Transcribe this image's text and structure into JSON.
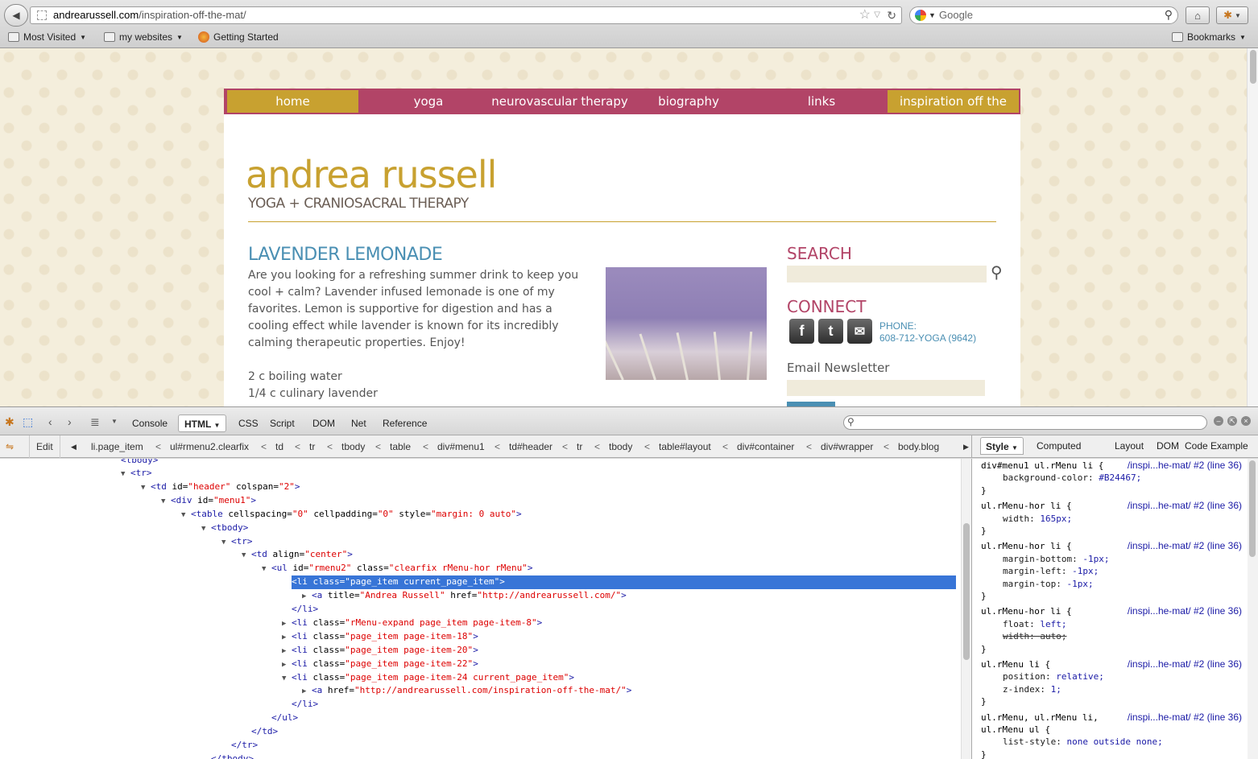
{
  "browser": {
    "url_host": "andrearussell.com",
    "url_path": "/inspiration-off-the-mat/",
    "search_placeholder": "Google",
    "bookmarks": [
      {
        "label": "Most Visited"
      },
      {
        "label": "my websites"
      },
      {
        "label": "Getting Started"
      }
    ],
    "bookmarks_menu": "Bookmarks"
  },
  "site": {
    "menu": [
      "home",
      "yoga",
      "neurovascular therapy",
      "biography",
      "links",
      "inspiration off the mat"
    ],
    "menu_current": [
      "home",
      "inspiration off the mat"
    ],
    "accent_color": "#B24467",
    "gold_color": "#C8A130",
    "logo_title": "andrea russell",
    "logo_subtitle": "YOGA + CRANIOSACRAL THERAPY",
    "post_title": "LAVENDER LEMONADE",
    "post_paragraph": "Are you looking for a refreshing summer drink to keep you cool + calm? Lavender infused lemonade is one of my favorites. Lemon is supportive for digestion and has a cooling effect while lavender is known for its incredibly calming therapeutic properties.  Enjoy!",
    "ingredients": [
      "2 c boiling water",
      "1/4  c culinary lavender"
    ],
    "sidebar": {
      "search_heading": "SEARCH",
      "connect_heading": "CONNECT",
      "phone_label": "PHONE:",
      "phone_number": "608-712-YOGA (9642)",
      "newsletter_heading": "Email Newsletter"
    }
  },
  "firebug": {
    "tabs": [
      "Console",
      "HTML",
      "CSS",
      "Script",
      "DOM",
      "Net",
      "Reference"
    ],
    "selected_tab": "HTML",
    "edit_label": "Edit",
    "breadcrumbs": [
      "li.page_item",
      "ul#rmenu2.clearfix",
      "td",
      "tr",
      "tbody",
      "table",
      "div#menu1",
      "td#header",
      "tr",
      "tbody",
      "table#layout",
      "div#container",
      "div#wrapper",
      "body.blog"
    ],
    "side_tabs": [
      "Style",
      "Computed",
      "Layout",
      "DOM",
      "Code Example"
    ],
    "tree": [
      {
        "indent": 6,
        "toggle": "▼",
        "text": "<tr>"
      },
      {
        "indent": 7,
        "toggle": "▼",
        "text": "<td id=\"header\" colspan=\"2\">"
      },
      {
        "indent": 8,
        "toggle": "▼",
        "text": "<div id=\"menu1\">"
      },
      {
        "indent": 9,
        "toggle": "▼",
        "text": "<table cellspacing=\"0\" cellpadding=\"0\" style=\"margin: 0 auto\">"
      },
      {
        "indent": 10,
        "toggle": "▼",
        "text": "<tbody>"
      },
      {
        "indent": 11,
        "toggle": "▼",
        "text": "<tr>"
      },
      {
        "indent": 12,
        "toggle": "▼",
        "text": "<td align=\"center\">"
      },
      {
        "indent": 13,
        "toggle": "▼",
        "text": "<ul id=\"rmenu2\" class=\"clearfix rMenu-hor rMenu\">"
      },
      {
        "indent": 14,
        "toggle": "▼",
        "text": "<li class=\"page_item current_page_item\">",
        "selected": true
      },
      {
        "indent": 15,
        "toggle": "▶",
        "text": "<a title=\"Andrea Russell\" href=\"http://andrearussell.com/\">"
      },
      {
        "indent": 14,
        "toggle": "",
        "text": "</li>"
      },
      {
        "indent": 14,
        "toggle": "▶",
        "text": "<li class=\"rMenu-expand page_item page-item-8\">"
      },
      {
        "indent": 14,
        "toggle": "▶",
        "text": "<li class=\"page_item page-item-18\">"
      },
      {
        "indent": 14,
        "toggle": "▶",
        "text": "<li class=\"page_item page-item-20\">"
      },
      {
        "indent": 14,
        "toggle": "▶",
        "text": "<li class=\"page_item page-item-22\">"
      },
      {
        "indent": 14,
        "toggle": "▼",
        "text": "<li class=\"page_item page-item-24 current_page_item\">"
      },
      {
        "indent": 15,
        "toggle": "▶",
        "text": "<a href=\"http://andrearussell.com/inspiration-off-the-mat/\">"
      },
      {
        "indent": 14,
        "toggle": "",
        "text": "</li>"
      },
      {
        "indent": 13,
        "toggle": "",
        "text": "</ul>"
      },
      {
        "indent": 12,
        "toggle": "",
        "text": "</td>"
      },
      {
        "indent": 11,
        "toggle": "",
        "text": "</tr>"
      },
      {
        "indent": 10,
        "toggle": "",
        "text": "</tbody>"
      }
    ],
    "css_rules": [
      {
        "selector": "div#menu1 ul.rMenu li {",
        "source": "/inspi...he-mat/ #2 (line 36)",
        "decls": [
          {
            "p": "background-color:",
            "v": "#B24467;"
          }
        ]
      },
      {
        "selector": "ul.rMenu-hor li {",
        "source": "/inspi...he-mat/ #2 (line 36)",
        "decls": [
          {
            "p": "width:",
            "v": "165px;"
          }
        ]
      },
      {
        "selector": "ul.rMenu-hor li {",
        "source": "/inspi...he-mat/ #2 (line 36)",
        "decls": [
          {
            "p": "margin-bottom:",
            "v": "-1px;"
          },
          {
            "p": "margin-left:",
            "v": "-1px;"
          },
          {
            "p": "margin-top:",
            "v": "-1px;"
          }
        ]
      },
      {
        "selector": "ul.rMenu-hor li {",
        "source": "/inspi...he-mat/ #2 (line 36)",
        "decls": [
          {
            "p": "float:",
            "v": "left;"
          },
          {
            "p": "width:",
            "v": "auto;",
            "over": true
          }
        ]
      },
      {
        "selector": "ul.rMenu li {",
        "source": "/inspi...he-mat/ #2 (line 36)",
        "decls": [
          {
            "p": "position:",
            "v": "relative;"
          },
          {
            "p": "z-index:",
            "v": "1;"
          }
        ]
      },
      {
        "selector": "ul.rMenu, ul.rMenu li,\nul.rMenu ul {",
        "source": "/inspi...he-mat/ #2 (line 36)",
        "decls": [
          {
            "p": "list-style:",
            "v": "none outside none;"
          }
        ]
      }
    ]
  }
}
